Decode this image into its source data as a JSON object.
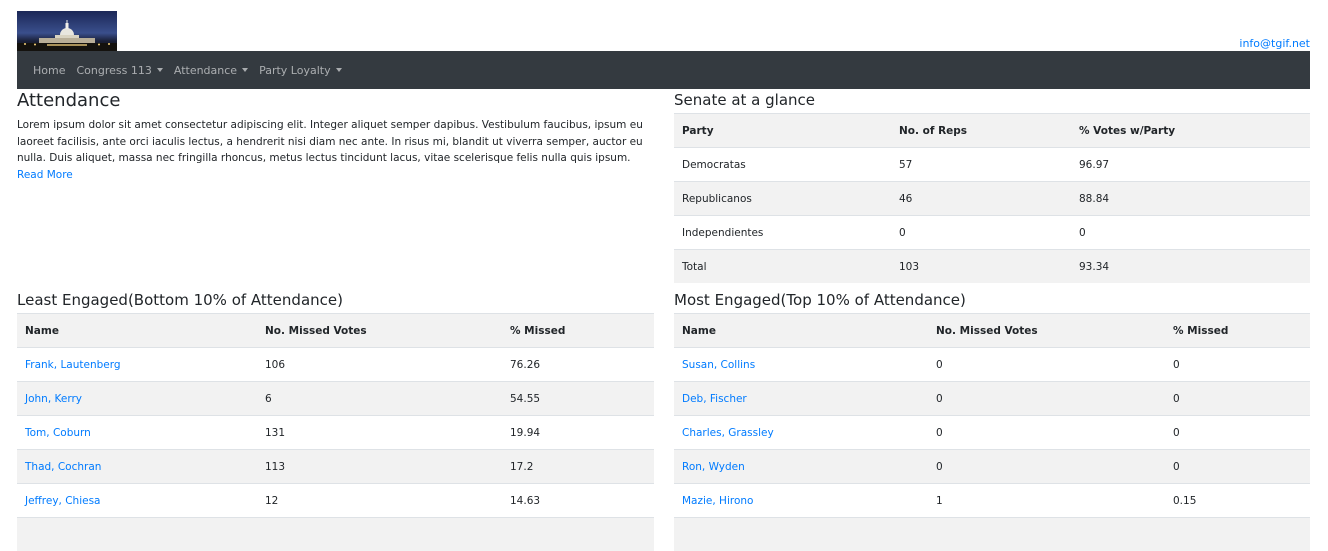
{
  "header": {
    "email": "info@tgif.net"
  },
  "nav": {
    "home": "Home",
    "congress": "Congress 113",
    "attendance": "Attendance",
    "party_loyalty": "Party Loyalty"
  },
  "main": {
    "title": "Attendance",
    "intro": "Lorem ipsum dolor sit amet consectetur adipiscing elit. Integer aliquet semper dapibus. Vestibulum faucibus, ipsum eu laoreet facilisis, ante orci iaculis lectus, a hendrerit nisi diam nec ante. In risus mi, blandit ut viverra semper, auctor eu nulla. Duis aliquet, massa nec fringilla rhoncus, metus lectus tincidunt lacus, vitae scelerisque felis nulla quis ipsum.",
    "read_more": "Read More"
  },
  "glance": {
    "title": "Senate at a glance",
    "headers": [
      "Party",
      "No. of Reps",
      "% Votes w/Party"
    ],
    "rows": [
      [
        "Democratas",
        "57",
        "96.97"
      ],
      [
        "Republicanos",
        "46",
        "88.84"
      ],
      [
        "Independientes",
        "0",
        "0"
      ],
      [
        "Total",
        "103",
        "93.34"
      ]
    ]
  },
  "least": {
    "title": "Least Engaged(Bottom 10% of Attendance)",
    "headers": [
      "Name",
      "No. Missed Votes",
      "% Missed"
    ],
    "rows": [
      [
        "Frank, Lautenberg",
        "106",
        "76.26"
      ],
      [
        "John, Kerry",
        "6",
        "54.55"
      ],
      [
        "Tom, Coburn",
        "131",
        "19.94"
      ],
      [
        "Thad, Cochran",
        "113",
        "17.2"
      ],
      [
        "Jeffrey, Chiesa",
        "12",
        "14.63"
      ]
    ]
  },
  "most": {
    "title": "Most Engaged(Top 10% of Attendance)",
    "headers": [
      "Name",
      "No. Missed Votes",
      "% Missed"
    ],
    "rows": [
      [
        "Susan, Collins",
        "0",
        "0"
      ],
      [
        "Deb, Fischer",
        "0",
        "0"
      ],
      [
        "Charles, Grassley",
        "0",
        "0"
      ],
      [
        "Ron, Wyden",
        "0",
        "0"
      ],
      [
        "Mazie, Hirono",
        "1",
        "0.15"
      ]
    ]
  }
}
